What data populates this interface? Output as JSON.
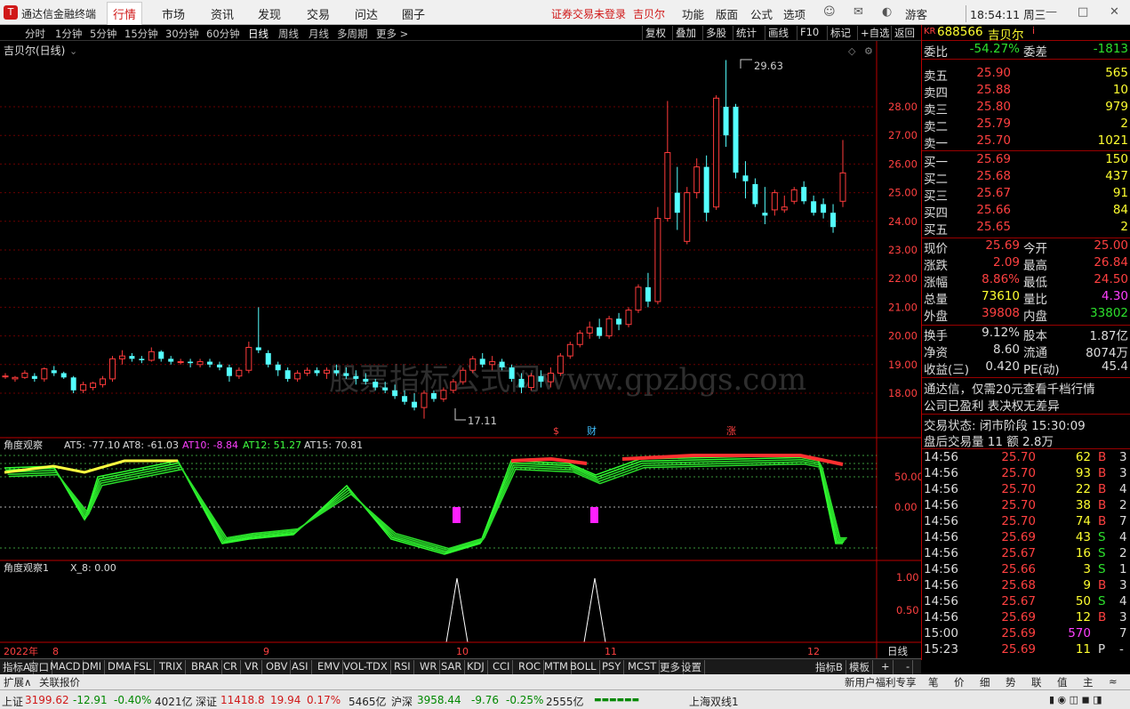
{
  "titlebar": {
    "app_title": "通达信金融终端",
    "menus": [
      "行情",
      "市场",
      "资讯",
      "发现",
      "交易",
      "问达",
      "圈子"
    ],
    "login_status": "证券交易未登录",
    "stock_name": "吉贝尔",
    "right_menus": [
      "功能",
      "版面",
      "公式",
      "选项"
    ],
    "guest": "游客",
    "clock": "18:54:11 周三"
  },
  "toolbar": {
    "periods": [
      "分时",
      "1分钟",
      "5分钟",
      "15分钟",
      "30分钟",
      "60分钟",
      "日线",
      "周线",
      "月线",
      "多周期",
      "更多 >"
    ],
    "actions": [
      "复权",
      "叠加",
      "多股",
      "统计",
      "画线",
      "F10",
      "标记",
      "+自选",
      "返回"
    ]
  },
  "chart": {
    "title": "吉贝尔(日线)",
    "watermark": "股票指标公式网www.gpzbgs.com",
    "price_labels": [
      "28.00",
      "27.00",
      "26.00",
      "25.00",
      "24.00",
      "23.00",
      "22.00",
      "21.00",
      "20.00",
      "19.00",
      "18.00"
    ],
    "high_label": "29.63",
    "low_label": "17.11",
    "markers": [
      "$",
      "财",
      "涨"
    ],
    "indicator1": {
      "name": "角度观察",
      "values": [
        {
          "label": "AT5: -77.10",
          "color": "#ffffff"
        },
        {
          "label": "AT8: -61.03",
          "color": "#ffffff"
        },
        {
          "label": "AT10: -8.84",
          "color": "#ff40ff"
        },
        {
          "label": "AT12: 51.27",
          "color": "#40ff40"
        },
        {
          "label": "AT15: 70.81",
          "color": "#ffffff"
        }
      ],
      "axis": [
        "50.00",
        "0.00"
      ]
    },
    "indicator2": {
      "name": "角度观察1",
      "value_label": "X_8: 0.00",
      "axis": [
        "1.00",
        "0.50"
      ]
    },
    "date_axis": [
      "2022年",
      "8",
      "9",
      "10",
      "11",
      "12"
    ],
    "period_label": "日线"
  },
  "quote": {
    "code": "688566",
    "name": "吉贝尔",
    "prefix": "KR",
    "weibi": {
      "label": "委比",
      "value": "-54.27%",
      "label2": "委差",
      "value2": "-1813"
    },
    "sells": [
      {
        "label": "卖五",
        "price": "25.90",
        "vol": "565"
      },
      {
        "label": "卖四",
        "price": "25.88",
        "vol": "10"
      },
      {
        "label": "卖三",
        "price": "25.80",
        "vol": "979"
      },
      {
        "label": "卖二",
        "price": "25.79",
        "vol": "2"
      },
      {
        "label": "卖一",
        "price": "25.70",
        "vol": "1021"
      }
    ],
    "buys": [
      {
        "label": "买一",
        "price": "25.69",
        "vol": "150"
      },
      {
        "label": "买二",
        "price": "25.68",
        "vol": "437"
      },
      {
        "label": "买三",
        "price": "25.67",
        "vol": "91"
      },
      {
        "label": "买四",
        "price": "25.66",
        "vol": "84"
      },
      {
        "label": "买五",
        "price": "25.65",
        "vol": "2"
      }
    ],
    "stats": [
      {
        "l1": "现价",
        "v1": "25.69",
        "c1": "red",
        "l2": "今开",
        "v2": "25.00",
        "c2": "red"
      },
      {
        "l1": "涨跌",
        "v1": "2.09",
        "c1": "red",
        "l2": "最高",
        "v2": "26.84",
        "c2": "red"
      },
      {
        "l1": "涨幅",
        "v1": "8.86%",
        "c1": "red",
        "l2": "最低",
        "v2": "24.50",
        "c2": "red"
      },
      {
        "l1": "总量",
        "v1": "73610",
        "c1": "yel",
        "l2": "量比",
        "v2": "4.30",
        "c2": "mag"
      },
      {
        "l1": "外盘",
        "v1": "39808",
        "c1": "red",
        "l2": "内盘",
        "v2": "33802",
        "c2": "grn"
      }
    ],
    "stats2": [
      {
        "l1": "换手",
        "v1": "9.12%",
        "l2": "股本",
        "v2": "1.87亿"
      },
      {
        "l1": "净资",
        "v1": "8.60",
        "l2": "流通",
        "v2": "8074万"
      },
      {
        "l1": "收益(三)",
        "v1": "0.420",
        "l2": "PE(动)",
        "v2": "45.4"
      }
    ],
    "notice1": "通达信，仅需20元查看千档行情",
    "notice2": "公司已盈利 表决权无差异",
    "trade_status": "交易状态: 闭市阶段 15:30:09",
    "after_hours": "盘后交易量 11 额 2.8万",
    "ticks": [
      {
        "time": "14:56",
        "price": "25.70",
        "vol": "62",
        "side": "B",
        "n": "3"
      },
      {
        "time": "14:56",
        "price": "25.70",
        "vol": "93",
        "side": "B",
        "n": "3"
      },
      {
        "time": "14:56",
        "price": "25.70",
        "vol": "22",
        "side": "B",
        "n": "4"
      },
      {
        "time": "14:56",
        "price": "25.70",
        "vol": "38",
        "side": "B",
        "n": "2"
      },
      {
        "time": "14:56",
        "price": "25.70",
        "vol": "74",
        "side": "B",
        "n": "7"
      },
      {
        "time": "14:56",
        "price": "25.69",
        "vol": "43",
        "side": "S",
        "n": "4"
      },
      {
        "time": "14:56",
        "price": "25.67",
        "vol": "16",
        "side": "S",
        "n": "2"
      },
      {
        "time": "14:56",
        "price": "25.66",
        "vol": "3",
        "side": "S",
        "n": "1"
      },
      {
        "time": "14:56",
        "price": "25.68",
        "vol": "9",
        "side": "B",
        "n": "3"
      },
      {
        "time": "14:56",
        "price": "25.67",
        "vol": "50",
        "side": "S",
        "n": "4"
      },
      {
        "time": "14:56",
        "price": "25.69",
        "vol": "12",
        "side": "B",
        "n": "3"
      },
      {
        "time": "15:00",
        "price": "25.69",
        "vol": "570",
        "side": "",
        "n": "7"
      },
      {
        "time": "15:23",
        "price": "25.69",
        "vol": "11",
        "side": "P",
        "n": "-"
      }
    ]
  },
  "tabs": [
    "指标A",
    "窗口",
    "MACD",
    "DMI",
    "DMA",
    "FSL",
    "TRIX",
    "BRAR",
    "CR",
    "VR",
    "OBV",
    "ASI",
    "EMV",
    "VOL-TDX",
    "RSI",
    "WR",
    "SAR",
    "KDJ",
    "CCI",
    "ROC",
    "MTM",
    "BOLL",
    "PSY",
    "MCST",
    "更多",
    "设置"
  ],
  "tabs_right": [
    "指标B",
    "模板",
    "+",
    "-"
  ],
  "tabs2_left": [
    "扩展∧",
    "关联报价"
  ],
  "tabs2_right": "新用户福利专享",
  "quote_tabs": [
    "笔",
    "价",
    "细",
    "势",
    "联",
    "值",
    "主",
    "≈"
  ],
  "status": {
    "sh_label": "上证",
    "sh_val": "3199.62",
    "sh_chg": "-12.91",
    "sh_pct": "-0.40%",
    "sh_amt": "4021亿",
    "sz_label": "深证",
    "sz_val": "11418.8",
    "sz_chg": "19.94",
    "sz_pct": "0.17%",
    "sz_amt": "5465亿",
    "hs_label": "沪深",
    "hs_val": "3958.44",
    "hs_chg": "-9.76",
    "hs_pct": "-0.25%",
    "hs_amt": "2555亿",
    "line": "上海双线1"
  },
  "candles": [
    [
      18.6,
      18.7,
      18.5,
      18.6
    ],
    [
      18.5,
      18.6,
      18.4,
      18.55
    ],
    [
      18.55,
      18.8,
      18.5,
      18.7
    ],
    [
      18.6,
      18.7,
      18.4,
      18.5
    ],
    [
      18.5,
      18.9,
      18.4,
      18.85
    ],
    [
      18.8,
      18.95,
      18.6,
      18.7
    ],
    [
      18.7,
      18.75,
      18.5,
      18.55
    ],
    [
      18.55,
      18.6,
      18.0,
      18.1
    ],
    [
      18.1,
      18.4,
      18.0,
      18.3
    ],
    [
      18.2,
      18.4,
      18.1,
      18.35
    ],
    [
      18.3,
      18.6,
      18.2,
      18.5
    ],
    [
      18.5,
      19.3,
      18.4,
      19.2
    ],
    [
      19.2,
      19.5,
      19.0,
      19.3
    ],
    [
      19.3,
      19.4,
      19.1,
      19.2
    ],
    [
      19.2,
      19.3,
      19.05,
      19.15
    ],
    [
      19.15,
      19.6,
      19.1,
      19.45
    ],
    [
      19.45,
      19.5,
      19.1,
      19.2
    ],
    [
      19.2,
      19.3,
      19.0,
      19.1
    ],
    [
      19.1,
      19.2,
      19.0,
      19.1
    ],
    [
      19.1,
      19.2,
      18.9,
      19.05
    ],
    [
      19.0,
      19.2,
      18.9,
      19.1
    ],
    [
      19.1,
      19.2,
      18.9,
      19.0
    ],
    [
      19.0,
      19.1,
      18.8,
      18.9
    ],
    [
      18.9,
      19.0,
      18.4,
      18.6
    ],
    [
      18.6,
      18.9,
      18.5,
      18.8
    ],
    [
      18.8,
      19.8,
      18.7,
      19.6
    ],
    [
      19.6,
      21.0,
      19.4,
      19.5
    ],
    [
      19.4,
      19.5,
      18.9,
      19.0
    ],
    [
      19.0,
      19.1,
      18.6,
      18.8
    ],
    [
      18.8,
      18.9,
      18.4,
      18.5
    ],
    [
      18.5,
      18.8,
      18.4,
      18.7
    ],
    [
      18.7,
      18.9,
      18.6,
      18.8
    ],
    [
      18.8,
      18.9,
      18.6,
      18.7
    ],
    [
      18.7,
      18.9,
      18.5,
      18.8
    ],
    [
      18.8,
      19.0,
      18.6,
      18.7
    ],
    [
      18.7,
      18.9,
      18.5,
      18.6
    ],
    [
      18.6,
      18.8,
      18.3,
      18.5
    ],
    [
      18.5,
      18.7,
      18.3,
      18.4
    ],
    [
      18.4,
      18.5,
      18.1,
      18.2
    ],
    [
      18.2,
      18.4,
      18.0,
      18.1
    ],
    [
      18.1,
      18.3,
      17.8,
      17.9
    ],
    [
      17.9,
      18.1,
      17.6,
      17.7
    ],
    [
      17.7,
      18.0,
      17.4,
      17.5
    ],
    [
      17.5,
      18.1,
      17.11,
      18.0
    ],
    [
      18.0,
      18.1,
      17.7,
      17.8
    ],
    [
      17.8,
      18.2,
      17.7,
      18.1
    ],
    [
      18.1,
      18.5,
      18.0,
      18.4
    ],
    [
      18.4,
      18.9,
      18.3,
      18.8
    ],
    [
      18.8,
      19.3,
      18.7,
      19.2
    ],
    [
      19.2,
      19.4,
      18.9,
      19.0
    ],
    [
      19.0,
      19.3,
      18.8,
      19.1
    ],
    [
      19.1,
      19.2,
      18.8,
      18.9
    ],
    [
      18.9,
      19.0,
      18.4,
      18.5
    ],
    [
      18.5,
      18.7,
      18.0,
      18.2
    ],
    [
      18.2,
      18.7,
      18.1,
      18.6
    ],
    [
      18.6,
      18.8,
      18.2,
      18.4
    ],
    [
      18.4,
      18.9,
      18.2,
      18.7
    ],
    [
      18.7,
      19.4,
      18.6,
      19.3
    ],
    [
      19.3,
      19.8,
      19.2,
      19.7
    ],
    [
      19.7,
      20.2,
      19.6,
      20.1
    ],
    [
      20.1,
      20.5,
      19.9,
      20.3
    ],
    [
      20.3,
      20.6,
      19.9,
      20.0
    ],
    [
      20.0,
      20.7,
      19.9,
      20.6
    ],
    [
      20.6,
      20.8,
      20.2,
      20.4
    ],
    [
      20.4,
      21.0,
      20.3,
      20.9
    ],
    [
      20.9,
      21.8,
      20.8,
      21.7
    ],
    [
      21.7,
      22.2,
      21.0,
      21.2
    ],
    [
      21.2,
      24.5,
      21.1,
      24.1
    ],
    [
      24.1,
      28.2,
      24.0,
      26.4
    ],
    [
      25.0,
      25.9,
      23.7,
      24.3
    ],
    [
      23.3,
      25.2,
      23.2,
      25.0
    ],
    [
      25.0,
      26.2,
      24.8,
      25.9
    ],
    [
      25.9,
      26.3,
      24.0,
      24.3
    ],
    [
      24.5,
      28.4,
      24.4,
      28.3
    ],
    [
      28.0,
      29.63,
      26.6,
      27.0
    ],
    [
      28.0,
      28.1,
      25.5,
      25.7
    ],
    [
      25.6,
      26.1,
      24.8,
      25.4
    ],
    [
      25.3,
      25.5,
      24.5,
      24.6
    ],
    [
      24.3,
      25.2,
      23.9,
      24.2
    ],
    [
      24.4,
      25.1,
      24.2,
      25.0
    ],
    [
      24.4,
      24.9,
      24.3,
      24.5
    ],
    [
      24.7,
      25.2,
      24.6,
      25.1
    ],
    [
      25.2,
      25.4,
      24.6,
      24.7
    ],
    [
      24.7,
      24.9,
      24.2,
      24.3
    ],
    [
      24.6,
      24.8,
      24.1,
      24.3
    ],
    [
      24.3,
      24.6,
      23.6,
      23.8
    ],
    [
      24.7,
      26.84,
      24.5,
      25.69
    ]
  ]
}
